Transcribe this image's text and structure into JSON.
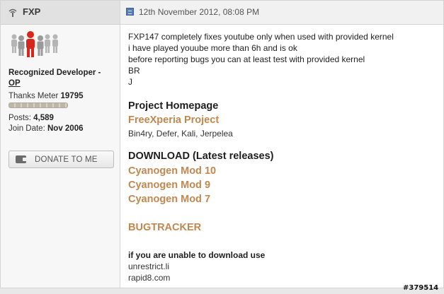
{
  "post": {
    "username": "FXP",
    "date": "12th November 2012, 08:08 PM",
    "message_lines": [
      "FXP147 completely fixes youtube only when used with provided kernel",
      "i have played youube more than 6h and is ok",
      "before reporting bugs you can at least test with provided kernel",
      "BR",
      "J"
    ],
    "project_heading": "Project Homepage",
    "project_link": "FreeXperia Project",
    "project_members": "Bin4ry, Defer, Kali, Jerpelea",
    "download_heading": "DOWNLOAD (Latest releases)",
    "download_links": [
      "Cyanogen Mod 10",
      "Cyanogen Mod 9",
      "Cyanogen Mod 7"
    ],
    "bugtracker_link": "BUGTRACKER",
    "alt_download_heading": "if you are unable to download use",
    "alt_links": [
      "unrestrict.li",
      "rapid8.com"
    ]
  },
  "user": {
    "title": "Recognized Developer -",
    "op_label": "OP",
    "thanks_label": "Thanks Meter",
    "thanks_count": "19795",
    "posts_label": "Posts:",
    "posts_count": "4,589",
    "join_label": "Join Date:",
    "join_date": "Nov 2006",
    "donate_label": "DONATE TO ME"
  },
  "image_stamp": "#379514",
  "colors": {
    "link": "#c1874f",
    "avatar_highlight": "#d8261c",
    "avatar_group": "#a8a8a8"
  }
}
